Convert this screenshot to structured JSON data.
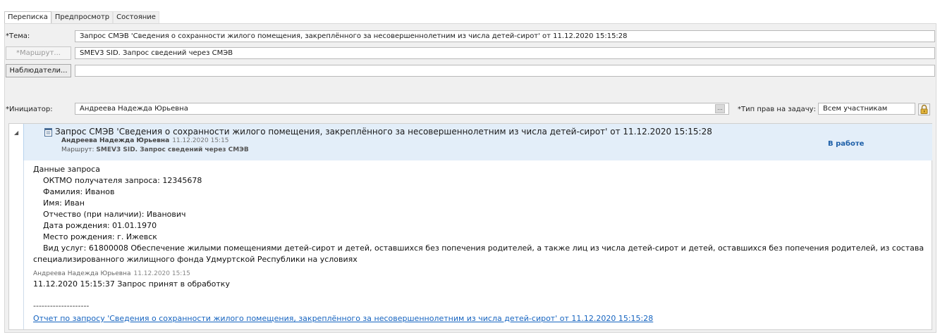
{
  "tabs": [
    {
      "label": "Переписка",
      "active": true
    },
    {
      "label": "Предпросмотр",
      "active": false
    },
    {
      "label": "Состояние",
      "active": false
    }
  ],
  "form": {
    "subject_label": "*Тема:",
    "subject_value": "Запрос СМЭВ 'Сведения о сохранности жилого помещения, закреплённого за несовершеннолетним из числа детей-сирот' от 11.12.2020 15:15:28",
    "route_button": "*Маршрут...",
    "route_value": "SMEV3 SID. Запрос сведений через СМЭВ",
    "observers_button": "Наблюдатели...",
    "observers_value": "",
    "initiator_label": "*Инициатор:",
    "initiator_value": "Андреева Надежда Юрьевна",
    "initiator_ellipsis": "...",
    "rights_label": "*Тип прав на задачу:",
    "rights_value": "Всем участникам"
  },
  "message": {
    "subject": "Запрос СМЭВ 'Сведения о сохранности жилого помещения, закреплённого за несовершеннолетним из числа детей-сирот' от 11.12.2020 15:15:28",
    "author": "Андреева Надежда Юрьевна",
    "date": "11.12.2020 15:15",
    "route_prefix": "Маршрут:",
    "route_value": "SMEV3 SID. Запрос сведений через СМЭВ",
    "status": "В работе",
    "body": {
      "heading": "Данные запроса",
      "lines": [
        "ОКТМО получателя запроса: 12345678",
        "Фамилия: Иванов",
        "Имя: Иван",
        "Отчество (при наличии): Иванович",
        "Дата рождения: 01.01.1970",
        "Место рождения: г. Ижевск",
        "Вид услуг: 61800008 Обеспечение жилыми помещениями детей-сирот и детей, оставшихся без попечения родителей, а также лиц из числа детей-сирот и детей, оставшихся без попечения родителей, из состава"
      ],
      "continuation": "специализированного жилищного фонда Удмуртской Республики на условиях"
    },
    "comment": {
      "author": "Андреева Надежда Юрьевна",
      "date": "11.12.2020 15:15",
      "text": "11.12.2020 15:15:37 Запрос принят в обработку"
    },
    "separator": "--------------------",
    "link": "Отчет по запросу 'Сведения о сохранности жилого помещения, закреплённого за несовершеннолетним из числа детей-сирот' от 11.12.2020 15:15:28"
  },
  "colors": {
    "header_bg": "#e3eef9",
    "status": "#1d5fa8",
    "link": "#1664c0"
  },
  "icons": [
    "collapse-triangle-icon",
    "document-icon",
    "lock-icon"
  ]
}
